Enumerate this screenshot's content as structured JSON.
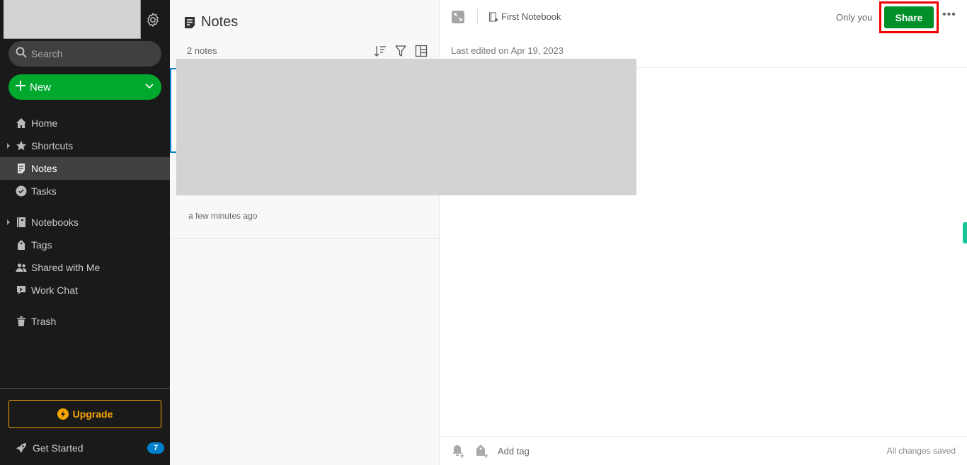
{
  "sidebar": {
    "search_placeholder": "Search",
    "new_label": "New",
    "items": [
      {
        "label": "Home",
        "icon": "home-icon"
      },
      {
        "label": "Shortcuts",
        "icon": "star-icon",
        "expandable": true
      },
      {
        "label": "Notes",
        "icon": "note-icon",
        "active": true
      },
      {
        "label": "Tasks",
        "icon": "check-circle-icon"
      },
      {
        "label": "Notebooks",
        "icon": "notebook-icon",
        "expandable": true
      },
      {
        "label": "Tags",
        "icon": "tag-icon"
      },
      {
        "label": "Shared with Me",
        "icon": "people-icon"
      },
      {
        "label": "Work Chat",
        "icon": "chat-icon"
      },
      {
        "label": "Trash",
        "icon": "trash-icon"
      }
    ],
    "upgrade_label": "Upgrade",
    "get_started_label": "Get Started",
    "get_started_badge": "7"
  },
  "notelist": {
    "title": "Notes",
    "count": "2 notes",
    "notes": [
      {
        "time": ""
      },
      {
        "time": "a few minutes ago"
      }
    ]
  },
  "editor": {
    "notebook": "First Notebook",
    "visibility": "Only you",
    "share_label": "Share",
    "more_label": "•••",
    "last_edited": "Last edited on Apr 19, 2023",
    "add_tag_placeholder": "Add tag",
    "save_status": "All changes saved"
  },
  "colors": {
    "brand_green": "#00a82d",
    "share_green": "#008f29",
    "upgrade_orange": "#f5a500",
    "selection_blue": "#0081cc",
    "highlight_red": "#ee0000"
  }
}
